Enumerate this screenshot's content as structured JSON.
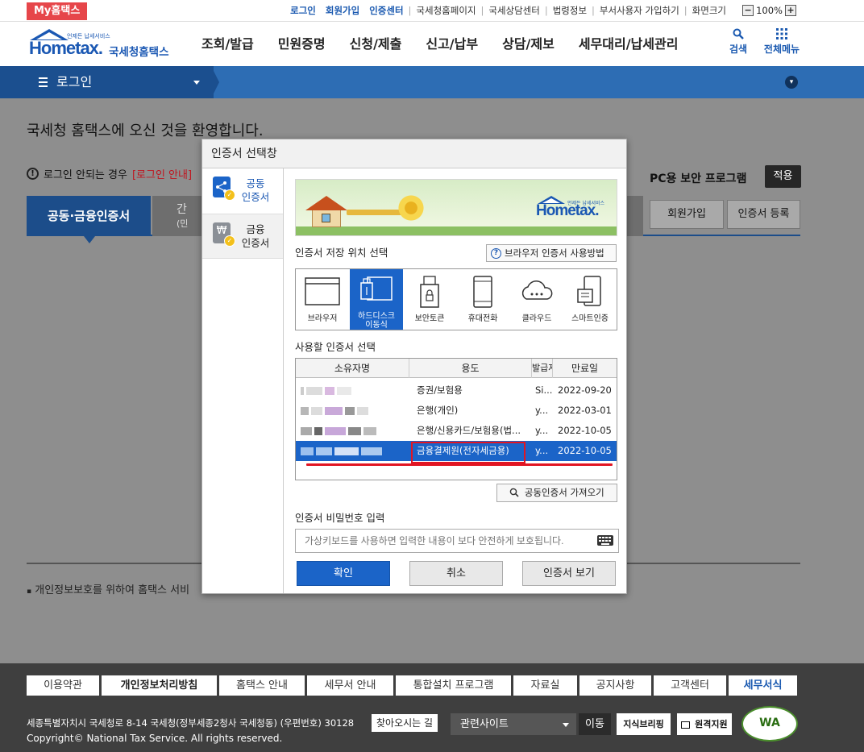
{
  "topbar": {
    "my_hometax": "My홈택스",
    "links": [
      "로그인",
      "회원가입",
      "인증센터",
      "국세청홈페이지",
      "국세상담센터",
      "법령정보",
      "부서사용자 가입하기",
      "화면크기"
    ],
    "zoom": "100%",
    "zoom_minus": "−",
    "zoom_plus": "+"
  },
  "header": {
    "logo_small": "언제든 납세서비스",
    "logo_text": "Hometax.",
    "site_name": "국세청홈택스",
    "nav": [
      "조회/발급",
      "민원증명",
      "신청/제출",
      "신고/납부",
      "상담/제보",
      "세무대리/납세관리"
    ],
    "search_label": "검색",
    "menu_label": "전체메뉴"
  },
  "loginbar": {
    "label": "로그인"
  },
  "page": {
    "welcome": "국세청 홈택스에 오신 것을 환영합니다.",
    "notice_prefix": "로그인 안되는 경우",
    "notice_link": "[로그인 안내]",
    "pc_security": "PC용 보안 프로그램",
    "apply_label": "적용",
    "tab_active": "공동·금융인증서",
    "tab_partial": "간",
    "tab_partial2": "(민",
    "join_label": "회원가입",
    "register_label": "인증서 등록",
    "privacy_note": "개인정보보호를 위하여 홈택스 서비"
  },
  "dialog": {
    "title": "인증서 선택창",
    "side_tabs": [
      {
        "label1": "공동",
        "label2": "인증서"
      },
      {
        "label1": "금융",
        "label2": "인증서"
      }
    ],
    "banner_logo": "Hometax.",
    "banner_small": "언제든 납세서비스",
    "location_label": "인증서 저장 위치 선택",
    "browser_help": "브라우저 인증서 사용방법",
    "locations": [
      {
        "label": "브라우저"
      },
      {
        "label": "하드디스크\n이동식"
      },
      {
        "label": "보안토큰"
      },
      {
        "label": "휴대전화"
      },
      {
        "label": "클라우드"
      },
      {
        "label": "스마트인증"
      }
    ],
    "cert_label": "사용할 인증서 선택",
    "columns": [
      "소유자명",
      "용도",
      "발급자",
      "만료일"
    ],
    "rows": [
      {
        "usage": "증권/보험용",
        "issuer": "Si...",
        "expiry": "2022-09-20"
      },
      {
        "usage": "은행(개인)",
        "issuer": "y...",
        "expiry": "2022-03-01"
      },
      {
        "usage": "은행/신용카드/보험용(법...",
        "issuer": "y...",
        "expiry": "2022-10-05"
      },
      {
        "usage": "금융결제원(전자세금용)",
        "issuer": "y...",
        "expiry": "2022-10-05"
      }
    ],
    "selected_row": 3,
    "import_label": "공동인증서 가져오기",
    "password_label": "인증서 비밀번호 입력",
    "password_placeholder": "가상키보드를 사용하면 입력한 내용이 보다 안전하게 보호됩니다.",
    "ok_label": "확인",
    "cancel_label": "취소",
    "view_label": "인증서 보기"
  },
  "footer": {
    "links": [
      "이용약관",
      "개인정보처리방침",
      "홈택스 안내",
      "세무서 안내",
      "통합설치 프로그램",
      "자료실",
      "공지사항",
      "고객센터",
      "세무서식"
    ],
    "address": "세종특별자치시 국세청로 8-14 국세청(정부세종2청사 국세청동) (우편번호) 30128",
    "find_road": "찾아오시는 길",
    "copyright": "Copyright© National Tax Service. All rights reserved.",
    "related_sites": "관련사이트",
    "go_label": "이동",
    "banner1": "지식브리핑",
    "banner2": "원격지원",
    "wa_badge": "WA"
  },
  "colors": {
    "primary_blue": "#1b64c8",
    "nav_blue": "#2d6db4",
    "highlight_red": "#e11523",
    "myhometax_red": "#e6464a"
  }
}
